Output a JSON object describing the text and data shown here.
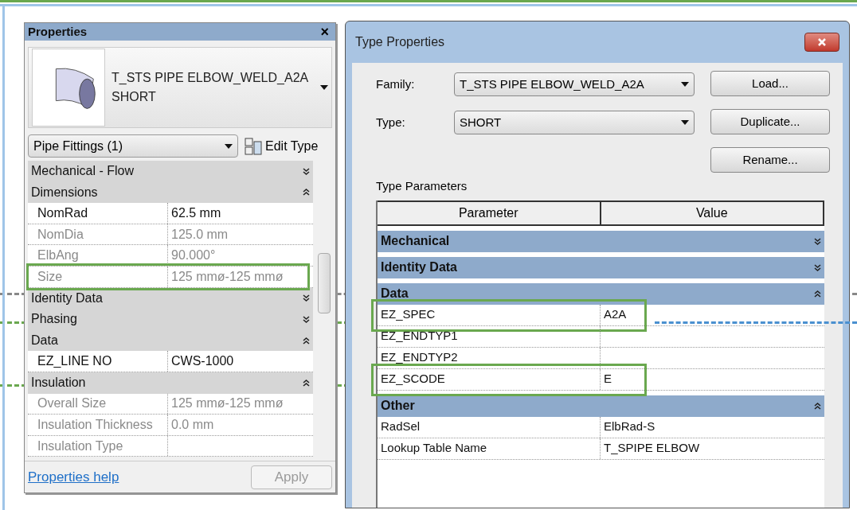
{
  "properties_panel": {
    "title": "Properties",
    "close": "×",
    "type_selector": {
      "family": "T_STS PIPE ELBOW_WELD_A2A",
      "type": "SHORT"
    },
    "filter": "Pipe Fittings (1)",
    "edit_type": "Edit Type",
    "rows": [
      {
        "kind": "group",
        "label": "Mechanical - Flow",
        "expanded": false
      },
      {
        "kind": "group",
        "label": "Dimensions",
        "expanded": true
      },
      {
        "kind": "param",
        "label": "NomRad",
        "value": "62.5 mm",
        "disabled": false,
        "highlighted": false
      },
      {
        "kind": "param",
        "label": "NomDia",
        "value": "125.0 mm",
        "disabled": true,
        "highlighted": false
      },
      {
        "kind": "param",
        "label": "ElbAng",
        "value": "90.000°",
        "disabled": true,
        "highlighted": false
      },
      {
        "kind": "param",
        "label": "Size",
        "value": "125 mmø-125 mmø",
        "disabled": true,
        "highlighted": true
      },
      {
        "kind": "group",
        "label": "Identity Data",
        "expanded": false
      },
      {
        "kind": "group",
        "label": "Phasing",
        "expanded": false
      },
      {
        "kind": "group",
        "label": "Data",
        "expanded": true
      },
      {
        "kind": "param",
        "label": "EZ_LINE NO",
        "value": "CWS-1000",
        "disabled": false,
        "highlighted": false
      },
      {
        "kind": "group",
        "label": "Insulation",
        "expanded": true
      },
      {
        "kind": "param",
        "label": "Overall Size",
        "value": "125 mmø-125 mmø",
        "disabled": true,
        "highlighted": false
      },
      {
        "kind": "param",
        "label": "Insulation Thickness",
        "value": "0.0 mm",
        "disabled": true,
        "highlighted": false
      },
      {
        "kind": "param",
        "label": "Insulation Type",
        "value": "",
        "disabled": true,
        "highlighted": false
      }
    ],
    "help_link": "Properties help",
    "apply": {
      "label": "Apply",
      "disabled": true
    }
  },
  "type_properties": {
    "title": "Type Properties",
    "family_label": "Family:",
    "family": "T_STS PIPE ELBOW_WELD_A2A",
    "type_label": "Type:",
    "type": "SHORT",
    "buttons": [
      "Load...",
      "Duplicate...",
      "Rename..."
    ],
    "section": "Type Parameters",
    "columns": [
      "Parameter",
      "Value"
    ],
    "rows": [
      {
        "kind": "group",
        "label": "Mechanical",
        "expanded": false
      },
      {
        "kind": "group",
        "label": "Identity Data",
        "expanded": false
      },
      {
        "kind": "group",
        "label": "Data",
        "expanded": true
      },
      {
        "kind": "param",
        "label": "EZ_SPEC",
        "value": "A2A",
        "highlighted": true
      },
      {
        "kind": "param",
        "label": "EZ_ENDTYP1",
        "value": "",
        "highlighted": false
      },
      {
        "kind": "param",
        "label": "EZ_ENDTYP2",
        "value": "",
        "highlighted": false
      },
      {
        "kind": "param",
        "label": "EZ_SCODE",
        "value": "E",
        "highlighted": true
      },
      {
        "kind": "group",
        "label": "Other",
        "expanded": true
      },
      {
        "kind": "param",
        "label": "RadSel",
        "value": "ElbRad-S",
        "highlighted": false
      },
      {
        "kind": "param",
        "label": "Lookup Table Name",
        "value": "T_SPIPE ELBOW",
        "highlighted": false
      }
    ]
  }
}
